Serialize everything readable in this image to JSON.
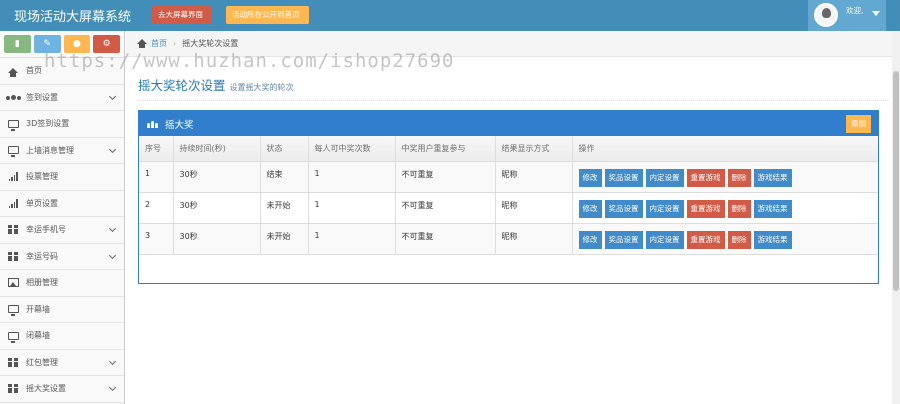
{
  "header": {
    "brand": "现场活动大屏幕系统",
    "screen_button": "去大屏幕界面",
    "sync_button": "活动所在公开到首页",
    "welcome": "欢迎,",
    "colors": {
      "bar": "#438eb9",
      "user_box": "#62a8d1"
    }
  },
  "sidebar": {
    "shortcuts": [
      {
        "icon": "comment-icon",
        "color": "#87b87f"
      },
      {
        "icon": "pencil-icon",
        "color": "#6fb3e0"
      },
      {
        "icon": "users-icon",
        "color": "#ffb752"
      },
      {
        "icon": "cogs-icon",
        "color": "#d15b47"
      }
    ],
    "items": [
      {
        "label": "首页",
        "icon": "dashboard-icon",
        "expandable": false
      },
      {
        "label": "签到设置",
        "icon": "users-icon",
        "expandable": true
      },
      {
        "label": "3D签到设置",
        "icon": "monitor-icon",
        "expandable": false
      },
      {
        "label": "上墙消息管理",
        "icon": "monitor-icon",
        "expandable": true
      },
      {
        "label": "投票管理",
        "icon": "signal-icon",
        "expandable": false
      },
      {
        "label": "单页设置",
        "icon": "signal-icon",
        "expandable": false
      },
      {
        "label": "幸运手机号",
        "icon": "gift-icon",
        "expandable": true
      },
      {
        "label": "幸运号码",
        "icon": "gift-icon",
        "expandable": true
      },
      {
        "label": "相册管理",
        "icon": "picture-icon",
        "expandable": false
      },
      {
        "label": "开幕墙",
        "icon": "monitor-icon",
        "expandable": false
      },
      {
        "label": "闭幕墙",
        "icon": "monitor-icon",
        "expandable": false
      },
      {
        "label": "红包管理",
        "icon": "gift-icon",
        "expandable": true
      },
      {
        "label": "摇大奖设置",
        "icon": "gift-icon",
        "expandable": true
      }
    ]
  },
  "breadcrumb": {
    "home": "首页",
    "current": "摇大奖轮次设置"
  },
  "page": {
    "title": "摇大奖轮次设置",
    "subtitle": "设置摇大奖的轮次"
  },
  "widget": {
    "title": "摇大奖",
    "add_button": "添加",
    "columns": [
      "序号",
      "持续时间(秒)",
      "状态",
      "每人可中奖次数",
      "中奖用户重复参与",
      "结果显示方式",
      "操作"
    ],
    "rows": [
      {
        "no": "1",
        "duration": "30秒",
        "status": "结束",
        "times": "1",
        "repeat": "不可重复",
        "display": "昵称"
      },
      {
        "no": "2",
        "duration": "30秒",
        "status": "未开始",
        "times": "1",
        "repeat": "不可重复",
        "display": "昵称"
      },
      {
        "no": "3",
        "duration": "30秒",
        "status": "未开始",
        "times": "1",
        "repeat": "不可重复",
        "display": "昵称"
      }
    ],
    "actions": {
      "edit": "修改",
      "prize": "奖品设置",
      "preset": "内定设置",
      "restart": "重置游戏",
      "delete": "删除",
      "result": "游戏结果"
    }
  },
  "watermark": "https://www.huzhan.com/ishop27690"
}
